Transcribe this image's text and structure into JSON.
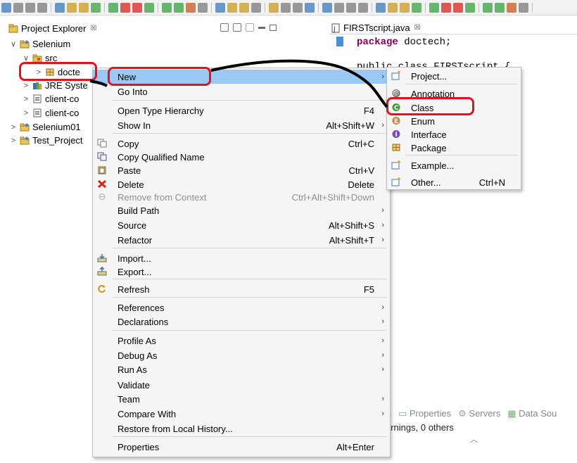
{
  "toolbar": {
    "icon_count": 40
  },
  "explorer": {
    "title": "Project Explorer",
    "close_glyph": "☒",
    "tree": [
      {
        "label": "Selenium",
        "twisty": "∨",
        "icon": "java-project-icon"
      },
      {
        "label": "src",
        "twisty": "∨",
        "icon": "source-folder-icon"
      },
      {
        "label": "docte",
        "twisty": ">",
        "icon": "package-icon"
      },
      {
        "label": "JRE Syste",
        "twisty": ">",
        "icon": "library-icon"
      },
      {
        "label": "client-co",
        "twisty": ">",
        "icon": "jar-icon"
      },
      {
        "label": "client-co",
        "twisty": ">",
        "icon": "jar-icon"
      },
      {
        "label": "Selenium01",
        "twisty": ">",
        "icon": "java-project-icon"
      },
      {
        "label": "Test_Project",
        "twisty": ">",
        "icon": "java-project-icon"
      }
    ]
  },
  "editor": {
    "tab_title": "FIRSTscript.java",
    "close_glyph": "☒",
    "line1_kw": "package",
    "line1_rest": " doctech;",
    "line2": "public class FIRSTscript {"
  },
  "bottom_panel": {
    "tabs": [
      "Properties",
      "Servers",
      "Data Sou"
    ],
    "status": "arnings, 0 others"
  },
  "context_menu": {
    "items": [
      {
        "label": "New",
        "shortcut": "",
        "arrow": "›",
        "icon": "",
        "highlighted": true,
        "disabled": false
      },
      {
        "label": "Go Into",
        "shortcut": "",
        "arrow": "",
        "icon": "",
        "disabled": false
      },
      {
        "label": "Open Type Hierarchy",
        "shortcut": "F4",
        "arrow": "",
        "icon": "",
        "disabled": false
      },
      {
        "label": "Show In",
        "shortcut": "Alt+Shift+W",
        "arrow": "›",
        "icon": "",
        "disabled": false
      },
      {
        "label": "Copy",
        "shortcut": "Ctrl+C",
        "arrow": "",
        "icon": "copy-icon",
        "disabled": false
      },
      {
        "label": "Copy Qualified Name",
        "shortcut": "",
        "arrow": "",
        "icon": "copy-qualified-icon",
        "disabled": false
      },
      {
        "label": "Paste",
        "shortcut": "Ctrl+V",
        "arrow": "",
        "icon": "paste-icon",
        "disabled": false
      },
      {
        "label": "Delete",
        "shortcut": "Delete",
        "arrow": "",
        "icon": "delete-icon",
        "disabled": false
      },
      {
        "label": "Remove from Context",
        "shortcut": "Ctrl+Alt+Shift+Down",
        "arrow": "",
        "icon": "remove-context-icon",
        "disabled": true
      },
      {
        "label": "Build Path",
        "shortcut": "",
        "arrow": "›",
        "icon": "",
        "disabled": false
      },
      {
        "label": "Source",
        "shortcut": "Alt+Shift+S",
        "arrow": "›",
        "icon": "",
        "disabled": false
      },
      {
        "label": "Refactor",
        "shortcut": "Alt+Shift+T",
        "arrow": "›",
        "icon": "",
        "disabled": false
      },
      {
        "label": "Import...",
        "shortcut": "",
        "arrow": "",
        "icon": "import-icon",
        "disabled": false
      },
      {
        "label": "Export...",
        "shortcut": "",
        "arrow": "",
        "icon": "export-icon",
        "disabled": false
      },
      {
        "label": "Refresh",
        "shortcut": "F5",
        "arrow": "",
        "icon": "refresh-icon",
        "disabled": false
      },
      {
        "label": "References",
        "shortcut": "",
        "arrow": "›",
        "icon": "",
        "disabled": false
      },
      {
        "label": "Declarations",
        "shortcut": "",
        "arrow": "›",
        "icon": "",
        "disabled": false
      },
      {
        "label": "Profile As",
        "shortcut": "",
        "arrow": "›",
        "icon": "",
        "disabled": false
      },
      {
        "label": "Debug As",
        "shortcut": "",
        "arrow": "›",
        "icon": "",
        "disabled": false
      },
      {
        "label": "Run As",
        "shortcut": "",
        "arrow": "›",
        "icon": "",
        "disabled": false
      },
      {
        "label": "Validate",
        "shortcut": "",
        "arrow": "",
        "icon": "",
        "disabled": false
      },
      {
        "label": "Team",
        "shortcut": "",
        "arrow": "›",
        "icon": "",
        "disabled": false
      },
      {
        "label": "Compare With",
        "shortcut": "",
        "arrow": "›",
        "icon": "",
        "disabled": false
      },
      {
        "label": "Restore from Local History...",
        "shortcut": "",
        "arrow": "",
        "icon": "",
        "disabled": false
      },
      {
        "label": "Properties",
        "shortcut": "Alt+Enter",
        "arrow": "",
        "icon": "",
        "disabled": false
      }
    ]
  },
  "submenu": {
    "items": [
      {
        "label": "Project...",
        "shortcut": "",
        "icon": "new-project-icon"
      },
      {
        "label": "Annotation",
        "shortcut": "",
        "icon": "annotation-icon"
      },
      {
        "label": "Class",
        "shortcut": "",
        "icon": "class-icon"
      },
      {
        "label": "Enum",
        "shortcut": "",
        "icon": "enum-icon"
      },
      {
        "label": "Interface",
        "shortcut": "",
        "icon": "interface-icon"
      },
      {
        "label": "Package",
        "shortcut": "",
        "icon": "package-icon"
      },
      {
        "label": "Example...",
        "shortcut": "",
        "icon": "example-icon"
      },
      {
        "label": "Other...",
        "shortcut": "Ctrl+N",
        "icon": "other-wizard-icon"
      }
    ]
  },
  "colors": {
    "highlight": "#99c9f4",
    "annotation": "#e0141e",
    "keyword": "#7f0055"
  }
}
